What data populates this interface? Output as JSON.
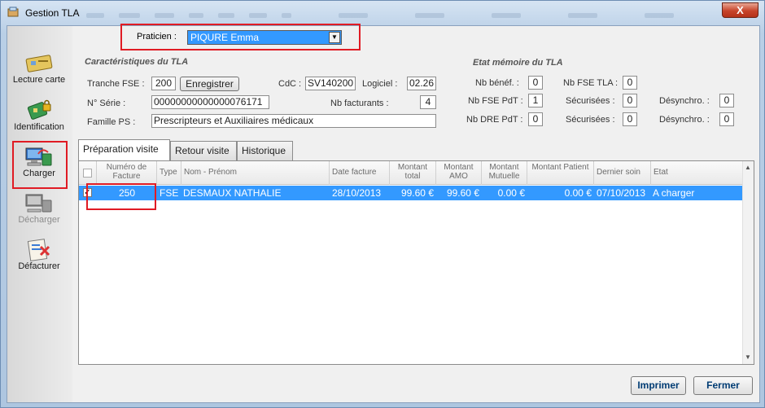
{
  "window": {
    "title": "Gestion TLA",
    "close_label": "X"
  },
  "sidebar": {
    "items": [
      {
        "label": "Lecture carte",
        "icon": "card-reader-icon"
      },
      {
        "label": "Identification",
        "icon": "id-card-lock-icon"
      },
      {
        "label": "Charger",
        "icon": "computer-upload-icon"
      },
      {
        "label": "Décharger",
        "icon": "computer-download-icon"
      },
      {
        "label": "Défacturer",
        "icon": "cancel-invoice-icon"
      }
    ]
  },
  "praticien": {
    "label": "Praticien :",
    "value": "PIQURE Emma"
  },
  "caract": {
    "title": "Caractéristiques du TLA",
    "tranche_label": "Tranche FSE :",
    "tranche_value": "200",
    "enregistrer_label": "Enregistrer",
    "cdc_label": "CdC :",
    "cdc_value": "SV140200",
    "logiciel_label": "Logiciel :",
    "logiciel_value": "02.26",
    "serie_label": "N° Série :",
    "serie_value": "00000000000000076171",
    "nbfact_label": "Nb facturants :",
    "nbfact_value": "4",
    "famille_label": "Famille PS :",
    "famille_value": "Prescripteurs et Auxiliaires médicaux"
  },
  "memoire": {
    "title": "Etat mémoire du TLA",
    "nbbenef_label": "Nb bénéf. :",
    "nbbenef_value": "0",
    "nbfsetla_label": "Nb FSE TLA :",
    "nbfsetla_value": "0",
    "nbfsepdt_label": "Nb FSE PdT :",
    "nbfsepdt_value": "1",
    "secur1_label": "Sécurisées :",
    "secur1_value": "0",
    "desync1_label": "Désynchro. :",
    "desync1_value": "0",
    "nbdrepdt_label": "Nb DRE PdT :",
    "nbdrepdt_value": "0",
    "secur2_label": "Sécurisées :",
    "secur2_value": "0",
    "desync2_label": "Désynchro. :",
    "desync2_value": "0"
  },
  "tabs": [
    {
      "label": "Préparation visite"
    },
    {
      "label": "Retour visite"
    },
    {
      "label": "Historique"
    }
  ],
  "grid": {
    "headers": {
      "numero": "Numéro de Facture",
      "type": "Type",
      "nom": "Nom - Prénom",
      "date": "Date facture",
      "mt_total": "Montant total",
      "mt_amo": "Montant AMO",
      "mt_mutuelle": "Montant Mutuelle",
      "mt_patient": "Montant Patient",
      "dernier": "Dernier soin",
      "etat": "Etat"
    },
    "rows": [
      {
        "checked": "✓",
        "numero": "250",
        "type": "FSE",
        "nom": "DESMAUX NATHALIE",
        "date": "28/10/2013",
        "mt_total": "99.60 €",
        "mt_amo": "99.60 €",
        "mt_mutuelle": "0.00 €",
        "mt_patient": "0.00 €",
        "dernier": "07/10/2013",
        "etat": "A charger"
      }
    ]
  },
  "footer": {
    "imprimer": "Imprimer",
    "fermer": "Fermer"
  },
  "colors": {
    "accent": "#3399ff",
    "highlight": "#e01b24"
  }
}
